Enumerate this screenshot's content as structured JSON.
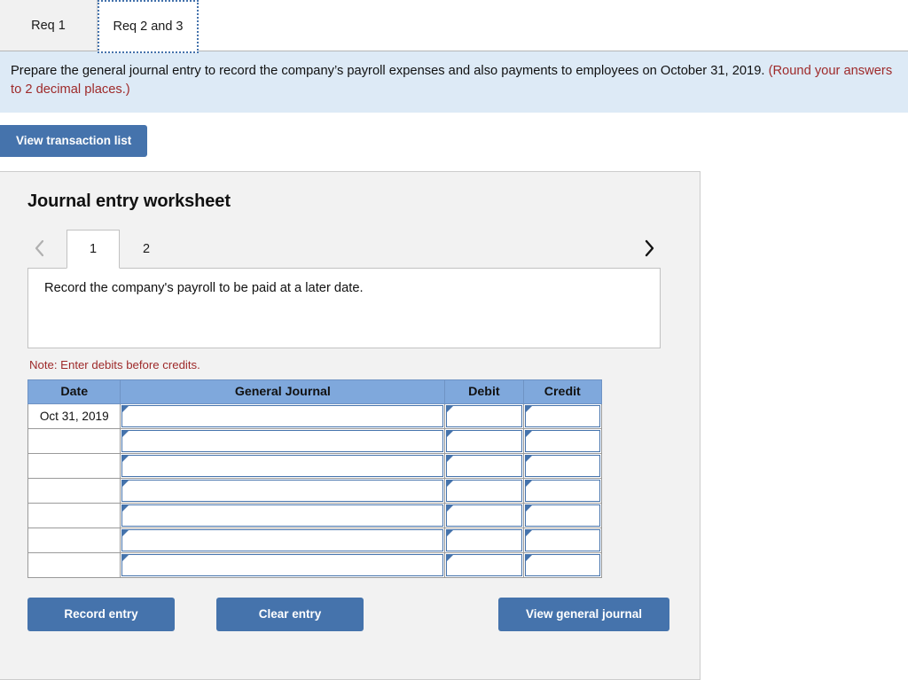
{
  "top_tabs": [
    {
      "label": "Req 1",
      "active": false
    },
    {
      "label": "Req 2 and 3",
      "active": true
    }
  ],
  "banner": {
    "text": "Prepare the general journal entry to record the company’s payroll expenses and also payments to employees on October 31, 2019. ",
    "hint": "(Round your answers to 2 decimal places.)"
  },
  "toolbar": {
    "view_transaction_list": "View transaction list"
  },
  "worksheet": {
    "title": "Journal entry worksheet",
    "pager": {
      "prev_icon": "chevron-left-icon",
      "next_icon": "chevron-right-icon",
      "pages": [
        {
          "label": "1",
          "active": true
        },
        {
          "label": "2",
          "active": false
        }
      ]
    },
    "description": "Record the company's payroll to be paid at a later date.",
    "note": "Note: Enter debits before credits."
  },
  "journal_table": {
    "columns": [
      "Date",
      "General Journal",
      "Debit",
      "Credit"
    ],
    "rows": [
      {
        "date": "Oct 31, 2019",
        "general_journal": "",
        "debit": "",
        "credit": ""
      },
      {
        "date": "",
        "general_journal": "",
        "debit": "",
        "credit": ""
      },
      {
        "date": "",
        "general_journal": "",
        "debit": "",
        "credit": ""
      },
      {
        "date": "",
        "general_journal": "",
        "debit": "",
        "credit": ""
      },
      {
        "date": "",
        "general_journal": "",
        "debit": "",
        "credit": ""
      },
      {
        "date": "",
        "general_journal": "",
        "debit": "",
        "credit": ""
      },
      {
        "date": "",
        "general_journal": "",
        "debit": "",
        "credit": ""
      }
    ]
  },
  "footer": {
    "record_entry": "Record entry",
    "clear_entry": "Clear entry",
    "view_general_journal": "View general journal"
  },
  "colors": {
    "button_blue": "#4573ac",
    "table_header_blue": "#7fa8dc",
    "banner_blue": "#ddeaf6",
    "panel_gray": "#f2f2f2",
    "note_red": "#9e2a2a"
  }
}
